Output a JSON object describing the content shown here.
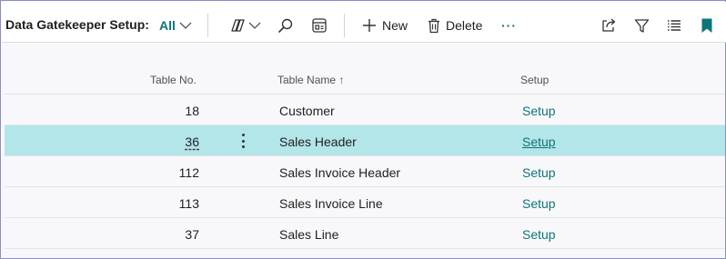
{
  "page": {
    "title": "Data Gatekeeper Setup:",
    "view": "All"
  },
  "toolbar": {
    "new_label": "New",
    "delete_label": "Delete",
    "more_label": "···"
  },
  "columns": {
    "table_no": "Table No.",
    "table_name": "Table Name",
    "sort_indicator": "↑",
    "setup": "Setup"
  },
  "rows": [
    {
      "table_no": "18",
      "table_name": "Customer",
      "setup": "Setup",
      "selected": false
    },
    {
      "table_no": "36",
      "table_name": "Sales Header",
      "setup": "Setup",
      "selected": true
    },
    {
      "table_no": "112",
      "table_name": "Sales Invoice Header",
      "setup": "Setup",
      "selected": false
    },
    {
      "table_no": "113",
      "table_name": "Sales Invoice Line",
      "setup": "Setup",
      "selected": false
    },
    {
      "table_no": "37",
      "table_name": "Sales Line",
      "setup": "Setup",
      "selected": false
    }
  ],
  "colors": {
    "accent": "#0e7478",
    "selected_row": "#b3e6e9",
    "frame_border": "#8a8fc6"
  },
  "icons": {
    "view_chevron": "chevron-down-icon",
    "copilot": "copilot-icon",
    "search": "search-icon",
    "edit_list": "edit-list-icon",
    "new": "plus-icon",
    "delete": "trash-icon",
    "share": "share-icon",
    "filter": "filter-icon",
    "list_view": "list-view-icon",
    "bookmark": "bookmark-icon"
  }
}
